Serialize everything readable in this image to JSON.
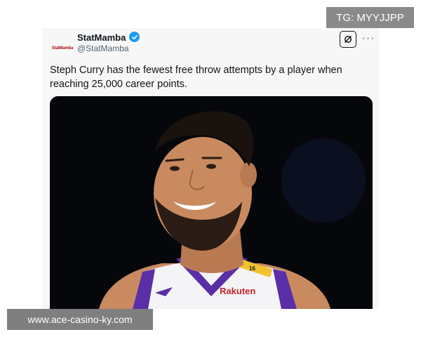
{
  "tweet": {
    "avatar_text": "StatMamba",
    "display_name": "StatMamba",
    "handle": "@StatMamba",
    "text": "Steph Curry has the fewest free throw attempts by a player when reaching 25,000 career points.",
    "media": {
      "jersey_sponsor": "Rakuten",
      "jersey_number": "16"
    }
  },
  "watermarks": {
    "top_right": "TG: MYYJJPP",
    "bottom_left": "www.ace-casino-ky.com"
  },
  "icons": {
    "verified": "verified-badge-icon",
    "grok": "grok-icon",
    "more": "more-options-icon"
  },
  "colors": {
    "verified": "#1d9bf0",
    "jersey_purple": "#5a2ea6",
    "jersey_gold": "#f2c230",
    "media_background": "#05070b"
  }
}
